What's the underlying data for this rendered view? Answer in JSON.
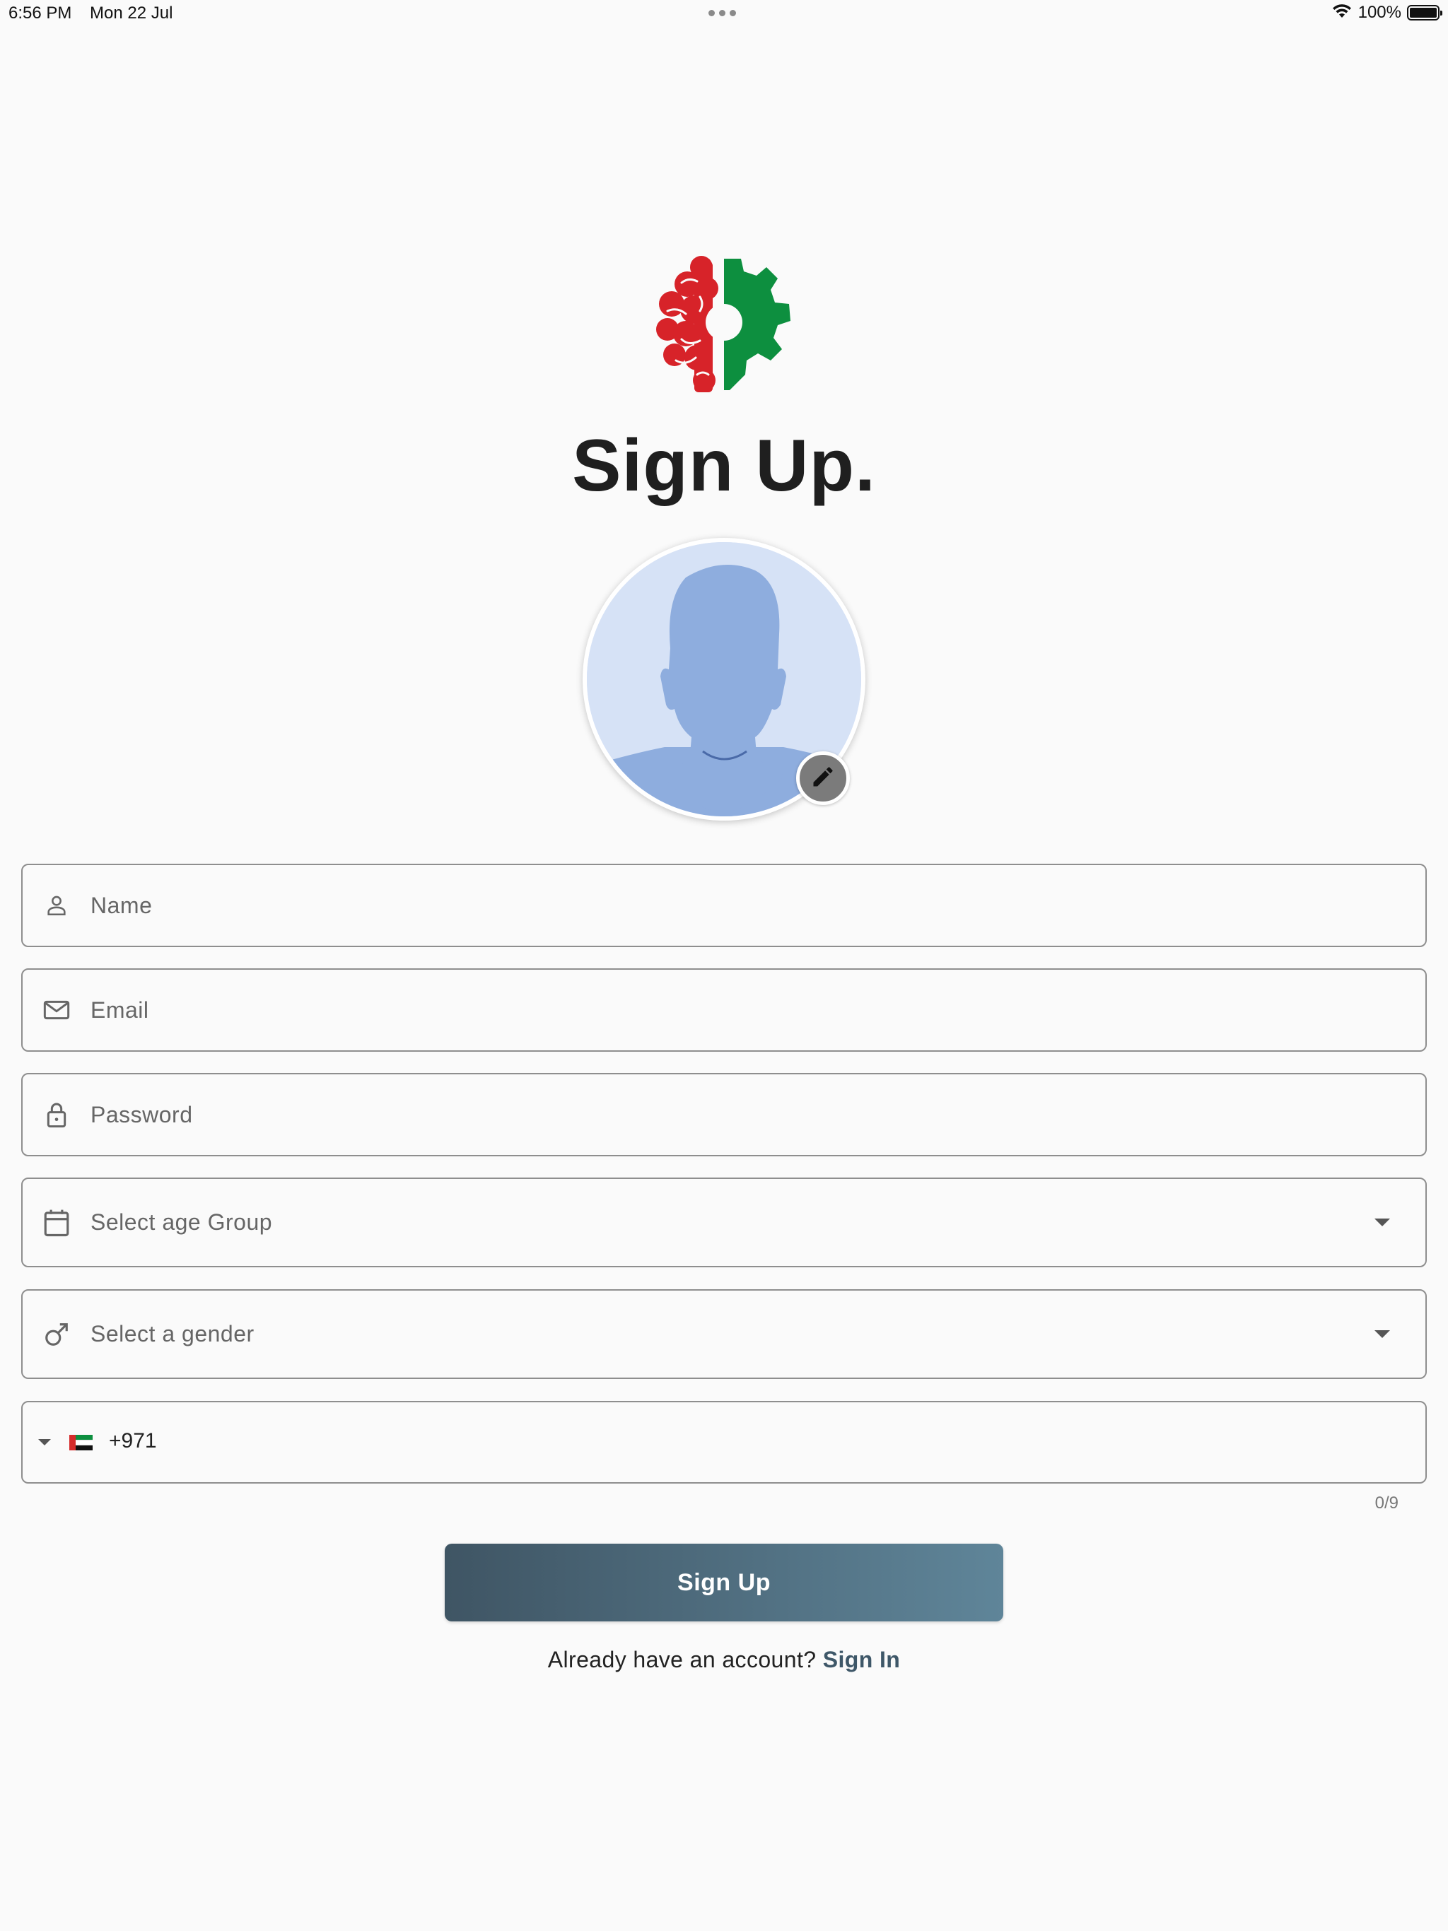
{
  "status_bar": {
    "time": "6:56 PM",
    "date": "Mon 22 Jul",
    "battery": "100%"
  },
  "title": "Sign Up.",
  "form": {
    "name_placeholder": "Name",
    "email_placeholder": "Email",
    "password_placeholder": "Password",
    "age_group_placeholder": "Select age Group",
    "gender_placeholder": "Select a gender",
    "phone_dial_code": "+971",
    "phone_counter": "0/9"
  },
  "signup_button": "Sign Up",
  "footer": {
    "prompt": "Already have an account?",
    "link": "Sign In"
  },
  "colors": {
    "logo_red": "#d72329",
    "logo_green": "#0d8f3f",
    "button_start": "#3f5564",
    "button_end": "#5f8599",
    "link": "#3e5768"
  },
  "icons": [
    "person-icon",
    "mail-icon",
    "lock-icon",
    "calendar-icon",
    "male-icon",
    "pencil-icon",
    "uae-flag-icon",
    "wifi-icon",
    "battery-icon"
  ]
}
